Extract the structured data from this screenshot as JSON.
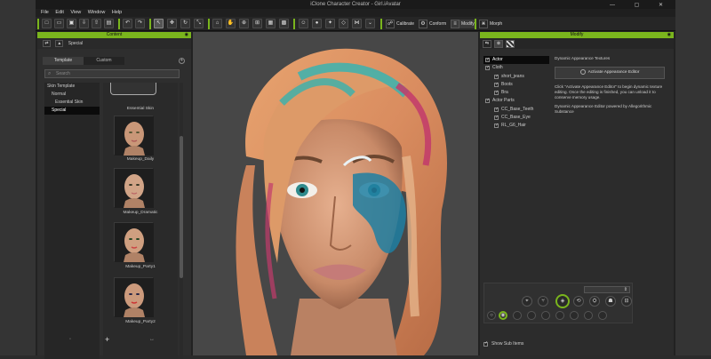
{
  "window": {
    "title": "iClone Character Creator - Girl.iAvatar",
    "controls": "—  ▢  ✕"
  },
  "menu": [
    "File",
    "Edit",
    "View",
    "Window",
    "Help"
  ],
  "toolbar": {
    "calibrate": "Calibrate",
    "conform": "Conform",
    "modify": "Modify",
    "morph": "Morph"
  },
  "content_panel": {
    "title": "Content",
    "breadcrumb": "Special",
    "tabs": [
      "Template",
      "Custom"
    ],
    "search_placeholder": "Search",
    "tree": [
      "Skin Template",
      "Normal",
      "Essential Skin",
      "Special"
    ],
    "thumbnails": [
      "Essential Skin",
      "Makeup_Daily",
      "Makeup_Dramatic",
      "Makeup_Party1",
      "Makeup_Party2"
    ],
    "bottom": {
      "add": "+"
    }
  },
  "modify_panel": {
    "title": "Modify",
    "tree": [
      {
        "label": "Actor",
        "selected": true
      },
      {
        "label": "Cloth",
        "checked": true
      },
      {
        "label": "short_jeans",
        "checked": true
      },
      {
        "label": "Boots",
        "checked": true
      },
      {
        "label": "Bra",
        "checked": true
      },
      {
        "label": "Actor Parts",
        "checked": true
      },
      {
        "label": "CC_Base_Teeth",
        "checked": true
      },
      {
        "label": "CC_Base_Eye",
        "checked": true
      },
      {
        "label": "RL_G6_Hair",
        "checked": true
      }
    ],
    "section_title": "Dynamic Appearance Textures",
    "button": "Activate Appearance Editor",
    "desc1": "Click \"Activate Appearance Editor\" to begin dynamic texture editing. Once the editing is finished, you can unload it to conserve memory usage.",
    "desc2": "Dynamic Appearance Editor powered by Allegorithmic Substance",
    "show_sub_items": "Show Sub Items"
  },
  "colors": {
    "accent": "#7ab51d",
    "panel_bg": "#2c2c2c",
    "viewport_bg": "#474747"
  }
}
